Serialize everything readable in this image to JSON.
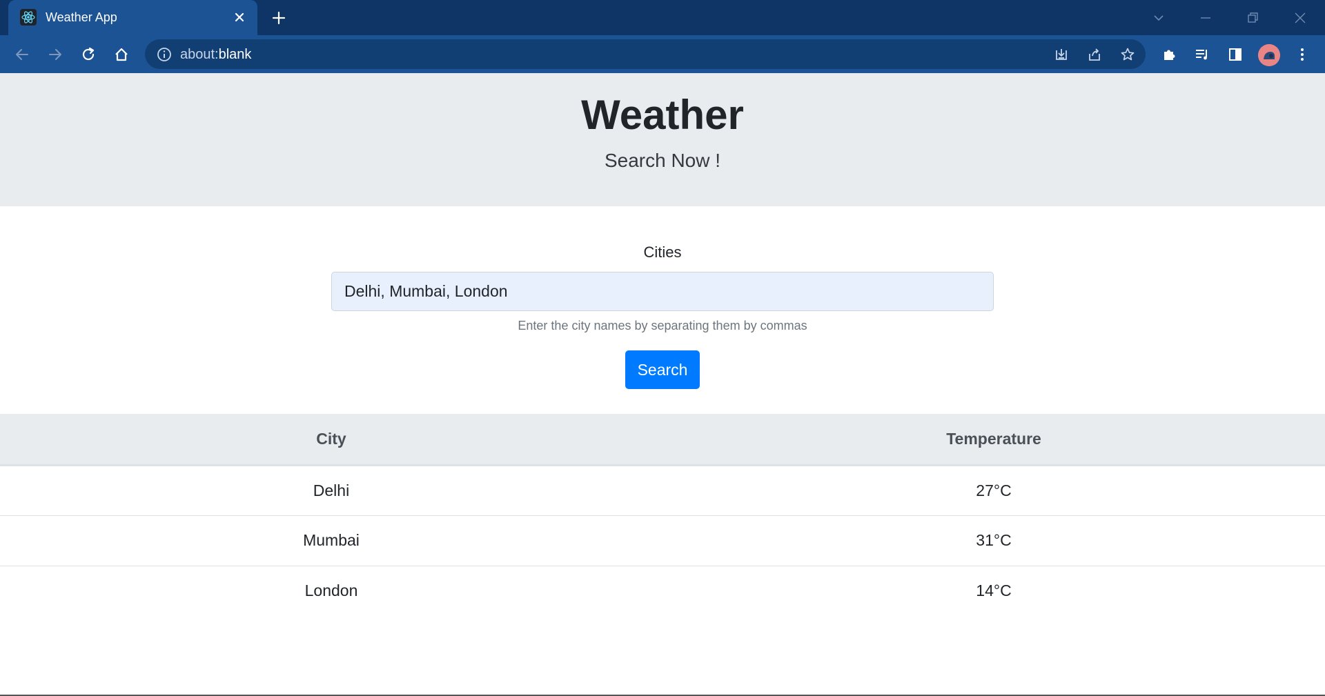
{
  "browser": {
    "tab_title": "Weather App",
    "url_prefix": "about:",
    "url_host": "blank"
  },
  "header": {
    "title": "Weather",
    "subtitle": "Search Now !"
  },
  "form": {
    "label": "Cities",
    "input_value": "Delhi, Mumbai, London",
    "help_text": "Enter the city names by separating them by commas",
    "button_label": "Search"
  },
  "table": {
    "headers": [
      "City",
      "Temperature"
    ],
    "rows": [
      {
        "city": "Delhi",
        "temperature": "27°C"
      },
      {
        "city": "Mumbai",
        "temperature": "31°C"
      },
      {
        "city": "London",
        "temperature": "14°C"
      }
    ]
  },
  "colors": {
    "chrome_tabstrip": "#0e3565",
    "chrome_toolbar": "#1c5395",
    "jumbotron_bg": "#e9ecef",
    "primary_button": "#007bff",
    "input_bg": "#e8f0fe"
  }
}
